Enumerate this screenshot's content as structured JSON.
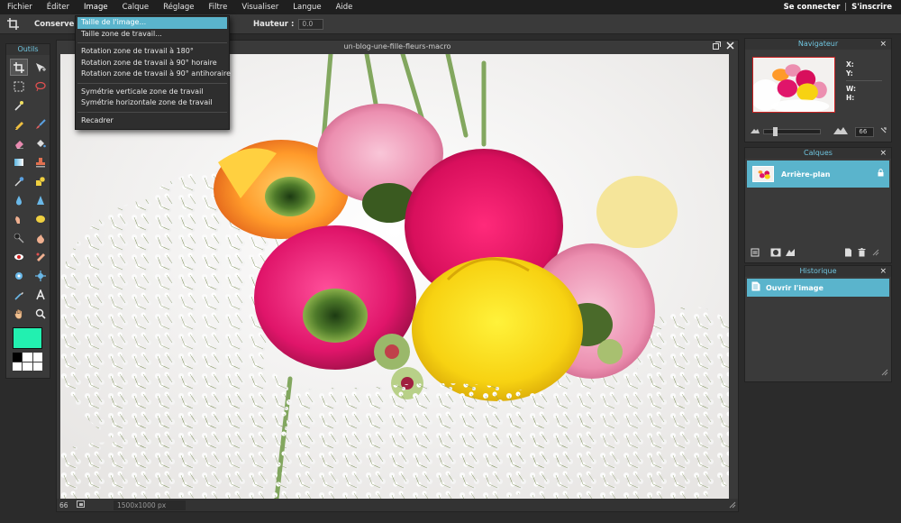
{
  "menu": {
    "items": [
      "Fichier",
      "Éditer",
      "Image",
      "Calque",
      "Réglage",
      "Filtre",
      "Visualiser",
      "Langue",
      "Aide"
    ],
    "login": "Se connecter",
    "signup": "S'inscrire",
    "separator": "|"
  },
  "options": {
    "keep_label": "Conserver :",
    "height_label": "Hauteur :",
    "height_value": "0.0"
  },
  "image_menu": {
    "group1": [
      "Taille de l'image...",
      "Taille zone de travail..."
    ],
    "group2": [
      "Rotation zone de travail à 180°",
      "Rotation zone de travail à 90° horaire",
      "Rotation zone de travail à 90° antihoraire"
    ],
    "group3": [
      "Symétrie verticale zone de travail",
      "Symétrie horizontale zone de travail"
    ],
    "group4": [
      "Recadrer"
    ]
  },
  "tools": {
    "title": "Outils",
    "icons": [
      "crop-icon",
      "move-icon",
      "marquee-icon",
      "lasso-icon",
      "magic-wand-icon",
      "pencil-icon",
      "brush-icon",
      "eraser-icon",
      "fill-bucket-icon",
      "gradient-icon",
      "stamp-icon",
      "color-replace-icon",
      "drawing-icon",
      "blur-icon",
      "sharpen-icon",
      "smudge-icon",
      "sponge-icon",
      "dodge-icon",
      "burn-icon",
      "red-eye-icon",
      "spot-heal-icon",
      "bloat-icon",
      "pinch-icon",
      "color-picker-icon",
      "type-icon",
      "hand-icon",
      "zoom-icon"
    ],
    "foreground_color": "#22f0b0"
  },
  "document": {
    "title": "un-blog-une-fille-fleurs-macro",
    "zoom": "66",
    "dimensions": "1500x1000 px"
  },
  "navigator": {
    "title": "Navigateur",
    "x_label": "X:",
    "y_label": "Y:",
    "w_label": "W:",
    "h_label": "H:",
    "zoom_value": "66"
  },
  "layers": {
    "title": "Calques",
    "items": [
      {
        "name": "Arrière-plan"
      }
    ]
  },
  "history": {
    "title": "Historique",
    "items": [
      {
        "label": "Ouvrir l'image"
      }
    ]
  },
  "colors": {
    "accent": "#5ab4cc",
    "panel_title": "#6fc5df"
  }
}
